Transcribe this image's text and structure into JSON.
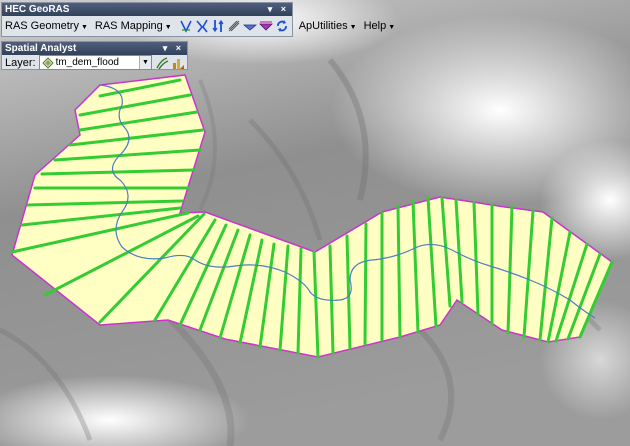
{
  "geoRasToolbar": {
    "title": "HEC GeoRAS",
    "controls": "▾ ×",
    "menus": [
      "RAS Geometry",
      "RAS Mapping",
      "ApUtilities",
      "Help"
    ],
    "tools": [
      "cross-section-tool",
      "flow-path-tool",
      "bank-lines-tool",
      "profile-tool",
      "levee-tool",
      "ineffective-area-tool",
      "refresh-tool"
    ]
  },
  "spatialAnalyst": {
    "title": "Spatial Analyst",
    "controls": "▾ ×",
    "layer_label": "Layer:",
    "layer_value": "tm_dem_flood",
    "tools": [
      "contour-tool",
      "histogram-tool"
    ]
  },
  "map": {
    "colors": {
      "floodplain_fill": "#ffffc4",
      "floodplain_outline": "#cc00cc",
      "cross_section": "#33cc33",
      "stream_centerline": "#4a7fc0",
      "hillshade": "#8c8c8c"
    },
    "layers": [
      "hillshade",
      "floodplain-polygon",
      "cross-section-lines",
      "stream-centerline"
    ]
  }
}
